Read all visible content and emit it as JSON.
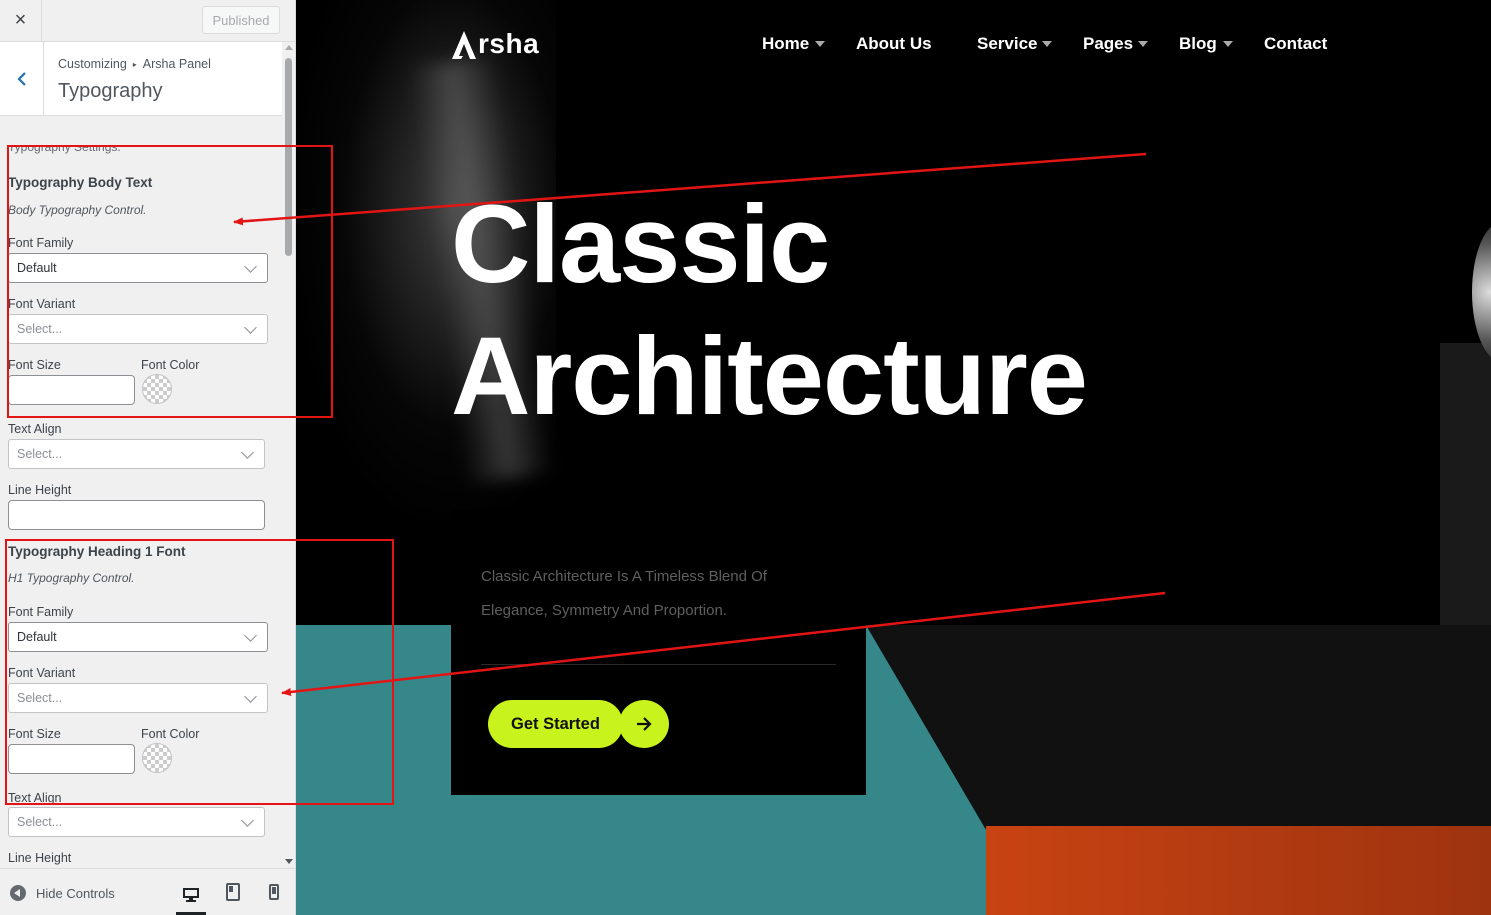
{
  "panel": {
    "close_icon": "×",
    "published_label": "Published",
    "breadcrumb": {
      "root": "Customizing",
      "separator": "▸",
      "parent": "Arsha Panel"
    },
    "title": "Typography",
    "section_intro": "Typography Settings.",
    "body_group": {
      "heading": "Typography Body Text",
      "description": "Body Typography Control.",
      "font_family_label": "Font Family",
      "font_family_value": "Default",
      "font_variant_label": "Font Variant",
      "font_variant_placeholder": "Select...",
      "font_size_label": "Font Size",
      "font_color_label": "Font Color",
      "text_align_label": "Text Align",
      "text_align_placeholder": "Select...",
      "line_height_label": "Line Height"
    },
    "h1_group": {
      "heading": "Typography Heading 1 Font",
      "description": "H1 Typography Control.",
      "font_family_label": "Font Family",
      "font_family_value": "Default",
      "font_variant_label": "Font Variant",
      "font_variant_placeholder": "Select...",
      "font_size_label": "Font Size",
      "font_color_label": "Font Color",
      "text_align_label": "Text Align",
      "text_align_placeholder": "Select...",
      "line_height_label": "Line Height"
    },
    "footer": {
      "hide_controls_label": "Hide Controls",
      "devices": [
        "desktop-icon",
        "tablet-icon",
        "mobile-icon"
      ]
    }
  },
  "preview": {
    "logo_text": "rsha",
    "nav": [
      {
        "label": "Home",
        "has_dropdown": true
      },
      {
        "label": "About Us",
        "has_dropdown": false
      },
      {
        "label": "Service",
        "has_dropdown": true
      },
      {
        "label": "Pages",
        "has_dropdown": true
      },
      {
        "label": "Blog",
        "has_dropdown": true
      },
      {
        "label": "Contact",
        "has_dropdown": false
      }
    ],
    "hero": {
      "title_line1": "Classic",
      "title_line2": "Architecture",
      "description": "Classic Architecture Is A Timeless Blend Of Elegance, Symmetry And Proportion.",
      "cta_label": "Get Started"
    }
  },
  "colors": {
    "accent": "#c9f31d",
    "annotation": "#e31414",
    "teal": "#36878a",
    "orange": "#c84312",
    "wp_blue": "#2271b1"
  }
}
